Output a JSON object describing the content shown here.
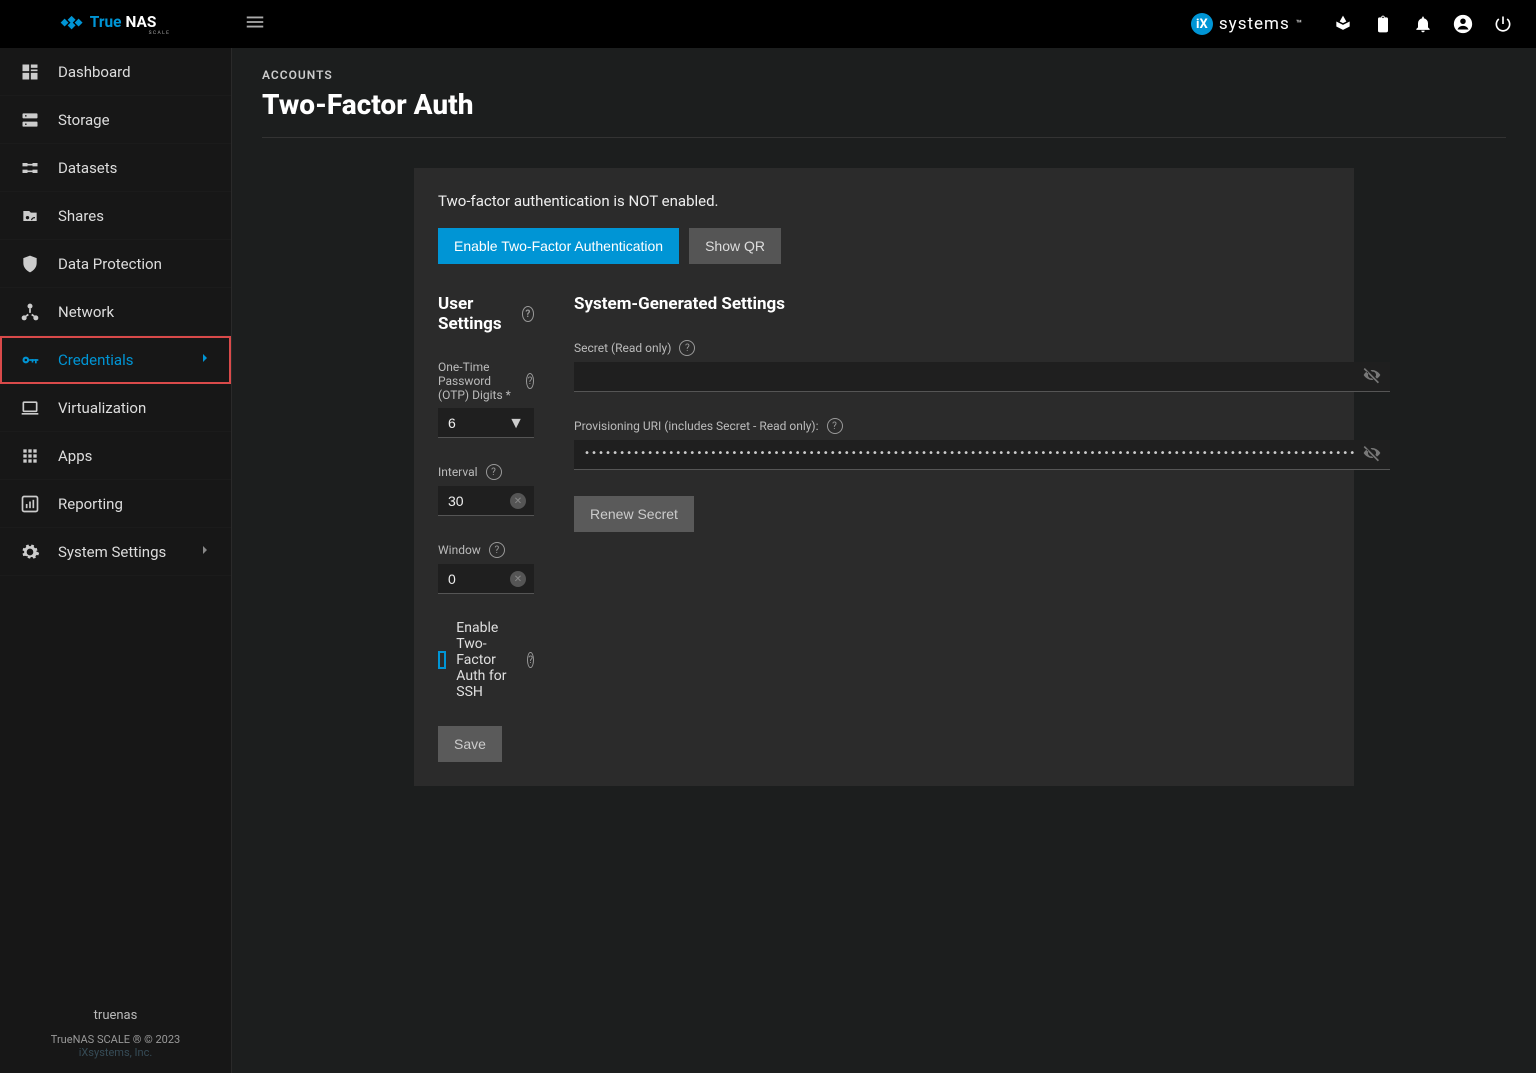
{
  "app": {
    "name": "TrueNAS",
    "subtitle": "SCALE"
  },
  "ixsystems": "systems",
  "breadcrumb": "ACCOUNTS",
  "page_title": "Two-Factor Auth",
  "sidebar": {
    "items": [
      {
        "label": "Dashboard",
        "icon": "dashboard"
      },
      {
        "label": "Storage",
        "icon": "storage"
      },
      {
        "label": "Datasets",
        "icon": "datasets"
      },
      {
        "label": "Shares",
        "icon": "shares"
      },
      {
        "label": "Data Protection",
        "icon": "shield"
      },
      {
        "label": "Network",
        "icon": "network"
      },
      {
        "label": "Credentials",
        "icon": "key",
        "active": true,
        "expandable": true,
        "highlighted": true
      },
      {
        "label": "Virtualization",
        "icon": "laptop"
      },
      {
        "label": "Apps",
        "icon": "apps"
      },
      {
        "label": "Reporting",
        "icon": "chart"
      },
      {
        "label": "System Settings",
        "icon": "gear",
        "expandable": true
      }
    ],
    "footer": {
      "hostname": "truenas",
      "version": "TrueNAS SCALE ® © 2023",
      "company": "iXsystems, Inc."
    }
  },
  "status_text": "Two-factor authentication is NOT enabled.",
  "buttons": {
    "enable": "Enable Two-Factor Authentication",
    "showqr": "Show QR",
    "save": "Save",
    "renew": "Renew Secret"
  },
  "user_settings": {
    "title": "User Settings",
    "otp_label": "One-Time Password (OTP) Digits *",
    "otp_value": "6",
    "interval_label": "Interval",
    "interval_value": "30",
    "window_label": "Window",
    "window_value": "0",
    "ssh_label": "Enable Two-Factor Auth for SSH"
  },
  "system_settings": {
    "title": "System-Generated Settings",
    "secret_label": "Secret (Read only)",
    "secret_value": "",
    "uri_label": "Provisioning URI (includes Secret - Read only):",
    "uri_value": "••••••••••••••••••••••••••••••••••••••••••••••••••••••••••••••••••••••••••••••••••••••••••••••••••••••••••••••"
  }
}
